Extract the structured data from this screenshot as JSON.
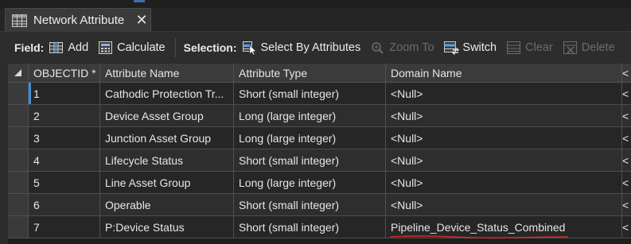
{
  "tab": {
    "title": "Network Attribute",
    "close_glyph": "✕"
  },
  "toolbar": {
    "field_label": "Field:",
    "add_label": "Add",
    "calculate_label": "Calculate",
    "selection_label": "Selection:",
    "select_by_attributes_label": "Select By Attributes",
    "zoom_to_label": "Zoom To",
    "switch_label": "Switch",
    "clear_label": "Clear",
    "delete_label": "Delete"
  },
  "table": {
    "columns": [
      "OBJECTID *",
      "Attribute Name",
      "Attribute Type",
      "Domain Name",
      "<"
    ],
    "rows": [
      {
        "objectid": "1",
        "name": "Cathodic Protection Tr...",
        "type": "Short (small integer)",
        "domain": "<Null>",
        "extra": "<"
      },
      {
        "objectid": "2",
        "name": "Device Asset Group",
        "type": "Long (large integer)",
        "domain": "<Null>",
        "extra": "<"
      },
      {
        "objectid": "3",
        "name": "Junction Asset Group",
        "type": "Long (large integer)",
        "domain": "<Null>",
        "extra": "<"
      },
      {
        "objectid": "4",
        "name": "Lifecycle Status",
        "type": "Short (small integer)",
        "domain": "<Null>",
        "extra": "<"
      },
      {
        "objectid": "5",
        "name": "Line Asset Group",
        "type": "Long (large integer)",
        "domain": "<Null>",
        "extra": "<"
      },
      {
        "objectid": "6",
        "name": "Operable",
        "type": "Short (small integer)",
        "domain": "<Null>",
        "extra": "<"
      },
      {
        "objectid": "7",
        "name": "P:Device Status",
        "type": "Short (small integer)",
        "domain": "Pipeline_Device_Status_Combined",
        "extra": "<"
      }
    ]
  },
  "icons": {
    "table": "table-icon",
    "add_field": "add-field-icon",
    "calculate": "calculator-icon",
    "select_by_attributes": "select-by-attributes-icon",
    "zoom_to": "zoom-to-icon",
    "switch": "switch-selection-icon",
    "clear": "clear-selection-icon",
    "delete": "delete-icon"
  },
  "colors": {
    "accent": "#3d8ee0",
    "annotation_underline": "#d42a2a"
  }
}
